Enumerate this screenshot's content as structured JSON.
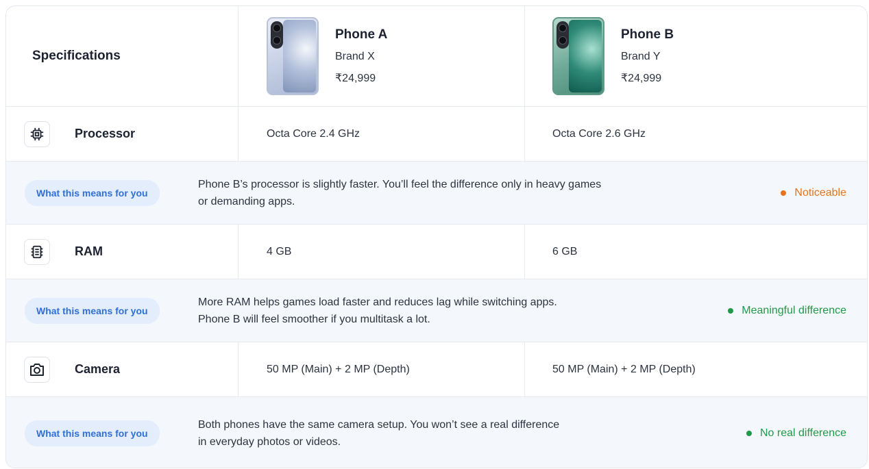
{
  "header": {
    "specs_title": "Specifications",
    "phones": [
      {
        "name": "Phone A",
        "brand": "Brand X",
        "price": "₹24,999",
        "image_icon": "phone-a-image"
      },
      {
        "name": "Phone B",
        "brand": "Brand Y",
        "price": "₹24,999",
        "image_icon": "phone-b-image"
      }
    ]
  },
  "specs": [
    {
      "label": "Processor",
      "icon": "processor-chip-icon",
      "values": [
        "Octa Core 2.4 GHz",
        "Octa Core 2.6 GHz"
      ],
      "means_pill": "What this means for you",
      "means_lines": [
        "Phone B’s processor is slightly faster. You’ll feel the difference only in heavy games",
        "or demanding apps."
      ],
      "verdict": "Noticeable",
      "verdict_color": "#e8731a"
    },
    {
      "label": "RAM",
      "icon": "ram-memory-icon",
      "values": [
        "4 GB",
        "6 GB"
      ],
      "means_pill": "What this means for you",
      "means_lines": [
        "More RAM helps games load faster and reduces lag while switching apps.",
        "Phone B will feel smoother if you multitask a lot."
      ],
      "verdict": "Meaningful difference",
      "verdict_color": "#1f9a47"
    },
    {
      "label": "Camera",
      "icon": "camera-icon",
      "values": [
        "50 MP (Main) + 2 MP (Depth)",
        "50 MP (Main) + 2 MP (Depth)"
      ],
      "means_pill": "What this means for you",
      "means_lines": [
        "Both phones have the same camera setup. You won’t see a real difference",
        "in everyday photos or videos."
      ],
      "verdict": "No real difference",
      "verdict_color": "#1f9a47"
    }
  ],
  "colors": {
    "accent_blue": "#2f6fd6",
    "pill_bg": "#e3edfb",
    "row_tint": "#f4f7fb"
  }
}
